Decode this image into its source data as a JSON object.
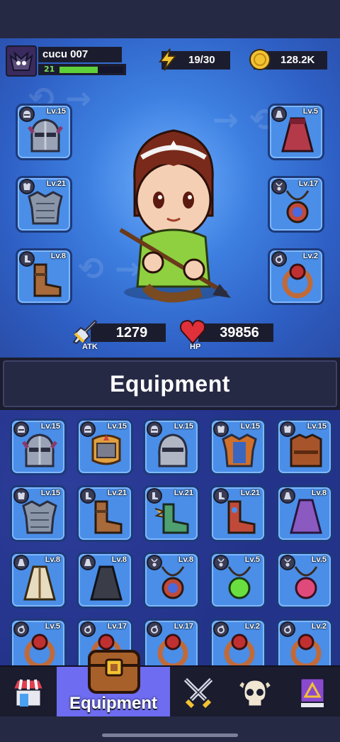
{
  "player": {
    "name": "cucu 007",
    "level": "21",
    "xp_fraction": 0.6,
    "avatar_icon": "bat-avatar-icon"
  },
  "resources": {
    "energy": "19/30",
    "gold": "128.2K"
  },
  "equipped": {
    "left": [
      {
        "type": "helmet",
        "level": "Lv.15",
        "icon": "dark-knight-helmet-icon"
      },
      {
        "type": "armor",
        "level": "Lv.21",
        "icon": "steel-plate-armor-icon"
      },
      {
        "type": "boots",
        "level": "Lv.8",
        "icon": "leather-boots-icon"
      }
    ],
    "right": [
      {
        "type": "cape",
        "level": "Lv.5",
        "icon": "red-cape-icon"
      },
      {
        "type": "necklace",
        "level": "Lv.17",
        "icon": "amulet-icon"
      },
      {
        "type": "ring",
        "level": "Lv.2",
        "icon": "ruby-ring-icon"
      }
    ]
  },
  "stats": {
    "atk_label": "ATK",
    "atk_value": "1279",
    "hp_label": "HP",
    "hp_value": "39856"
  },
  "section_title": "Equipment",
  "inventory": [
    {
      "type": "helmet",
      "level": "Lv.15",
      "icon": "purple-horned-helmet-icon"
    },
    {
      "type": "helmet",
      "level": "Lv.15",
      "icon": "gold-crown-helmet-icon"
    },
    {
      "type": "helmet",
      "level": "Lv.15",
      "icon": "steel-knight-helmet-icon"
    },
    {
      "type": "armor",
      "level": "Lv.15",
      "icon": "orange-plate-armor-icon"
    },
    {
      "type": "armor",
      "level": "Lv.15",
      "icon": "brown-robe-armor-icon"
    },
    {
      "type": "armor",
      "level": "Lv.15",
      "icon": "steel-plate-armor-icon"
    },
    {
      "type": "boots",
      "level": "Lv.21",
      "icon": "leather-boots-icon"
    },
    {
      "type": "boots",
      "level": "Lv.21",
      "icon": "winged-boots-icon"
    },
    {
      "type": "boots",
      "level": "Lv.21",
      "icon": "red-boots-icon"
    },
    {
      "type": "cape",
      "level": "Lv.8",
      "icon": "purple-cape-icon"
    },
    {
      "type": "cape",
      "level": "Lv.8",
      "icon": "cream-cape-icon"
    },
    {
      "type": "cape",
      "level": "Lv.8",
      "icon": "black-cape-icon"
    },
    {
      "type": "necklace",
      "level": "Lv.8",
      "icon": "amulet-icon"
    },
    {
      "type": "necklace",
      "level": "Lv.5",
      "icon": "green-gem-necklace-icon"
    },
    {
      "type": "necklace",
      "level": "Lv.5",
      "icon": "pink-gem-necklace-icon"
    },
    {
      "type": "ring",
      "level": "Lv.5",
      "icon": "ruby-ring-icon"
    },
    {
      "type": "ring",
      "level": "Lv.17",
      "icon": "ruby-ring-icon"
    },
    {
      "type": "ring",
      "level": "Lv.17",
      "icon": "ruby-ring-icon"
    },
    {
      "type": "ring",
      "level": "Lv.2",
      "icon": "ruby-ring-icon"
    },
    {
      "type": "ring",
      "level": "Lv.2",
      "icon": "ruby-ring-icon"
    }
  ],
  "nav": {
    "items": [
      {
        "name": "shop",
        "icon": "shop-icon"
      },
      {
        "name": "equipment",
        "icon": "chest-icon",
        "label": "Equipment",
        "active": true
      },
      {
        "name": "battle",
        "icon": "crossed-swords-icon"
      },
      {
        "name": "monsters",
        "icon": "skull-icon"
      },
      {
        "name": "spellbook",
        "icon": "spellbook-icon"
      }
    ]
  },
  "colors": {
    "slot_bg": "#4a8ee8",
    "nav_active": "#6e6cf0",
    "panel_dark": "#1b1d2f",
    "xp_green": "#5ed03a"
  }
}
